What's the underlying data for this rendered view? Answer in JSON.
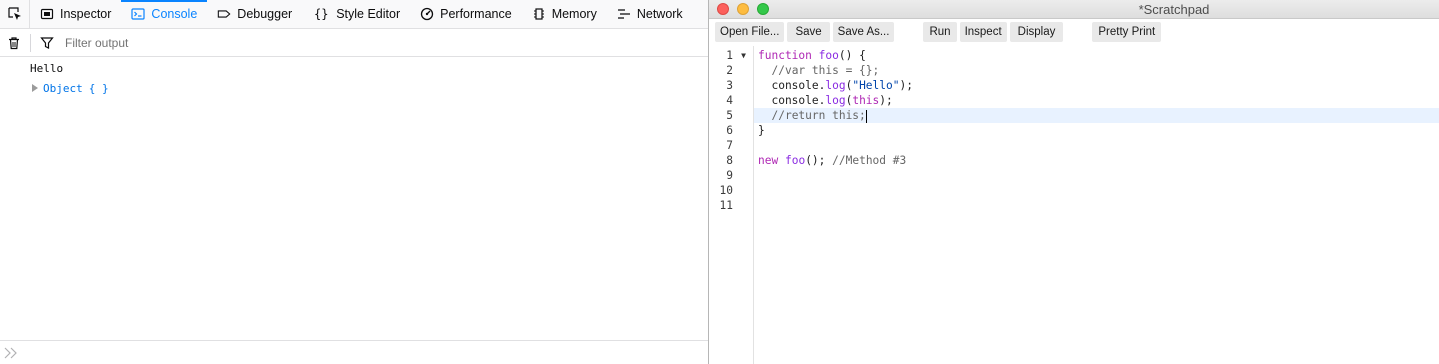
{
  "devtools": {
    "tabs": [
      {
        "label": "Inspector",
        "icon": "inspector-icon",
        "selected": false
      },
      {
        "label": "Console",
        "icon": "console-icon",
        "selected": true
      },
      {
        "label": "Debugger",
        "icon": "debugger-icon",
        "selected": false
      },
      {
        "label": "Style Editor",
        "icon": "style-editor-icon",
        "selected": false
      },
      {
        "label": "Performance",
        "icon": "performance-icon",
        "selected": false
      },
      {
        "label": "Memory",
        "icon": "memory-icon",
        "selected": false
      },
      {
        "label": "Network",
        "icon": "network-icon",
        "selected": false
      }
    ],
    "filter": {
      "placeholder": "Filter output",
      "value": ""
    },
    "messages": [
      {
        "type": "log",
        "text": "Hello"
      },
      {
        "type": "object",
        "text": "Object",
        "brace": "{  }"
      }
    ],
    "accent": "#0a84ff"
  },
  "scratchpad": {
    "title": "*Scratchpad",
    "toolbar": {
      "open_file": "Open File...",
      "save": "Save",
      "save_as": "Save As...",
      "run": "Run",
      "inspect": "Inspect",
      "display": "Display",
      "pretty_print": "Pretty Print"
    },
    "line_numbers": [
      "1",
      "2",
      "3",
      "4",
      "5",
      "6",
      "7",
      "8",
      "9",
      "10",
      "11"
    ],
    "code": [
      "function foo() {",
      "  //var this = {};",
      "  console.log(\"Hello\");",
      "  console.log(this);",
      "  //return this;",
      "}",
      "",
      "new foo(); //Method #3",
      "",
      "",
      ""
    ],
    "active_line": 5
  }
}
